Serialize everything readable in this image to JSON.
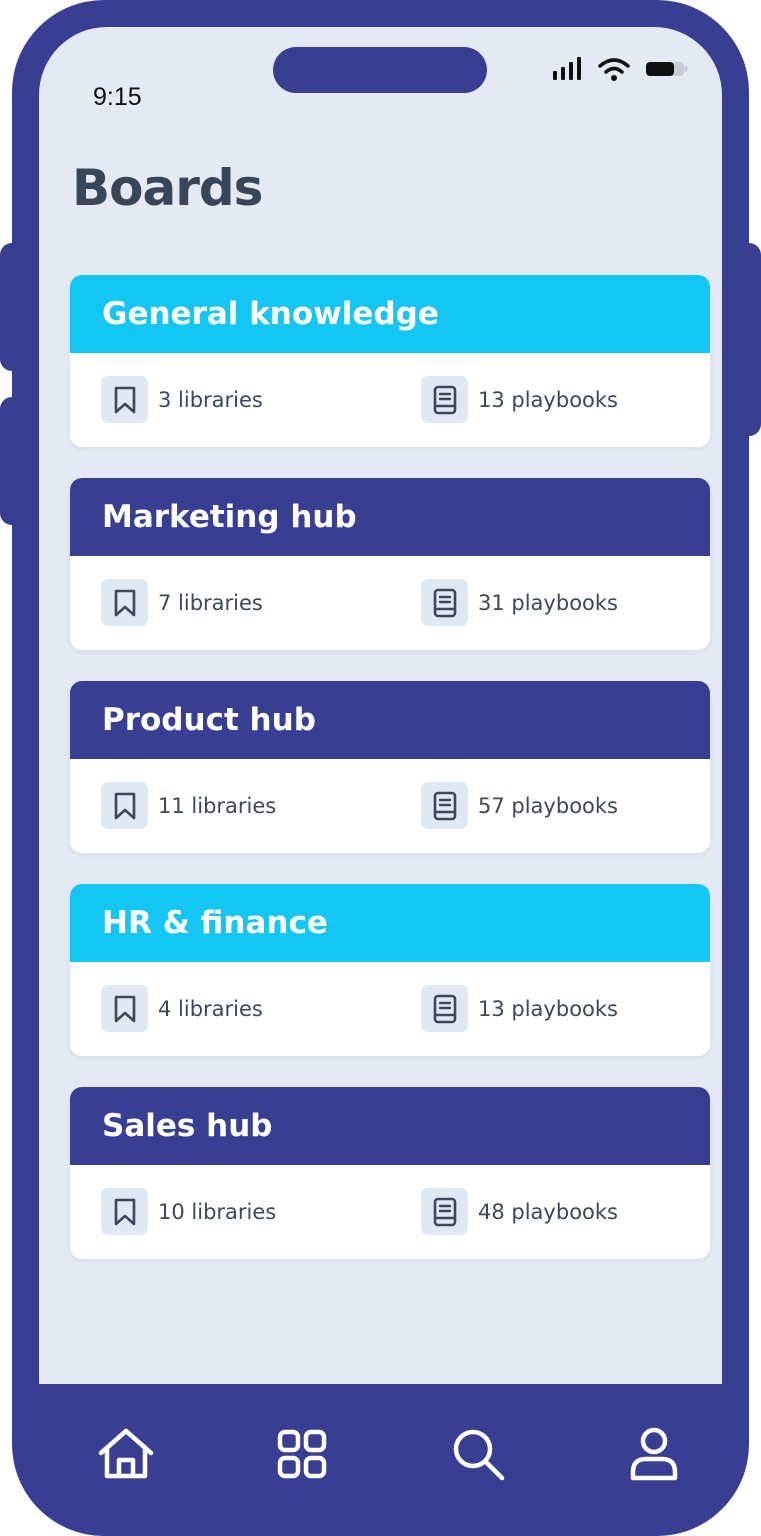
{
  "status_bar": {
    "time": "9:15"
  },
  "page": {
    "title": "Boards"
  },
  "colors": {
    "frame": "#383e91",
    "screen_bg": "#e5e9f3",
    "accent_cyan": "#14c6f4",
    "accent_indigo": "#383e91"
  },
  "boards": [
    {
      "name": "General knowledge",
      "color": "#14c6f4",
      "libraries": "3 libraries",
      "playbooks": "13 playbooks"
    },
    {
      "name": "Marketing hub",
      "color": "#383e91",
      "libraries": "7 libraries",
      "playbooks": "31 playbooks"
    },
    {
      "name": "Product hub",
      "color": "#383e91",
      "libraries": "11 libraries",
      "playbooks": "57 playbooks"
    },
    {
      "name": "HR & finance",
      "color": "#14c6f4",
      "libraries": "4 libraries",
      "playbooks": "13 playbooks"
    },
    {
      "name": "Sales hub",
      "color": "#383e91",
      "libraries": "10 libraries",
      "playbooks": "48 playbooks"
    }
  ],
  "nav": [
    {
      "icon": "home-icon"
    },
    {
      "icon": "grid-icon"
    },
    {
      "icon": "search-icon"
    },
    {
      "icon": "profile-icon"
    }
  ]
}
